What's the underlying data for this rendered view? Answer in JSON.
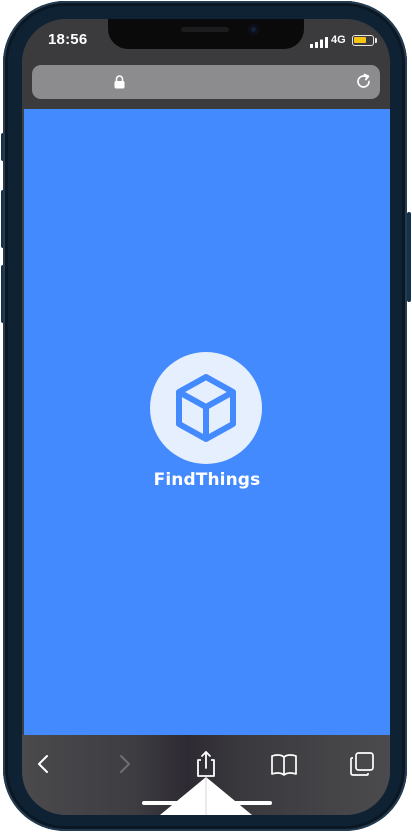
{
  "status_bar": {
    "time": "18:56",
    "network": "4G",
    "battery_level": 0.7
  },
  "browser": {
    "lock_icon": "lock-icon",
    "reload_icon": "reload-icon"
  },
  "page": {
    "background_color": "#448aff",
    "brand_name": "FindThings",
    "logo_icon": "cube-icon"
  },
  "toolbar": {
    "buttons": [
      {
        "icon": "back-icon",
        "enabled": true
      },
      {
        "icon": "forward-icon",
        "enabled": false
      },
      {
        "icon": "share-icon",
        "enabled": true
      },
      {
        "icon": "bookmarks-icon",
        "enabled": true
      },
      {
        "icon": "tabs-icon",
        "enabled": true
      }
    ]
  }
}
